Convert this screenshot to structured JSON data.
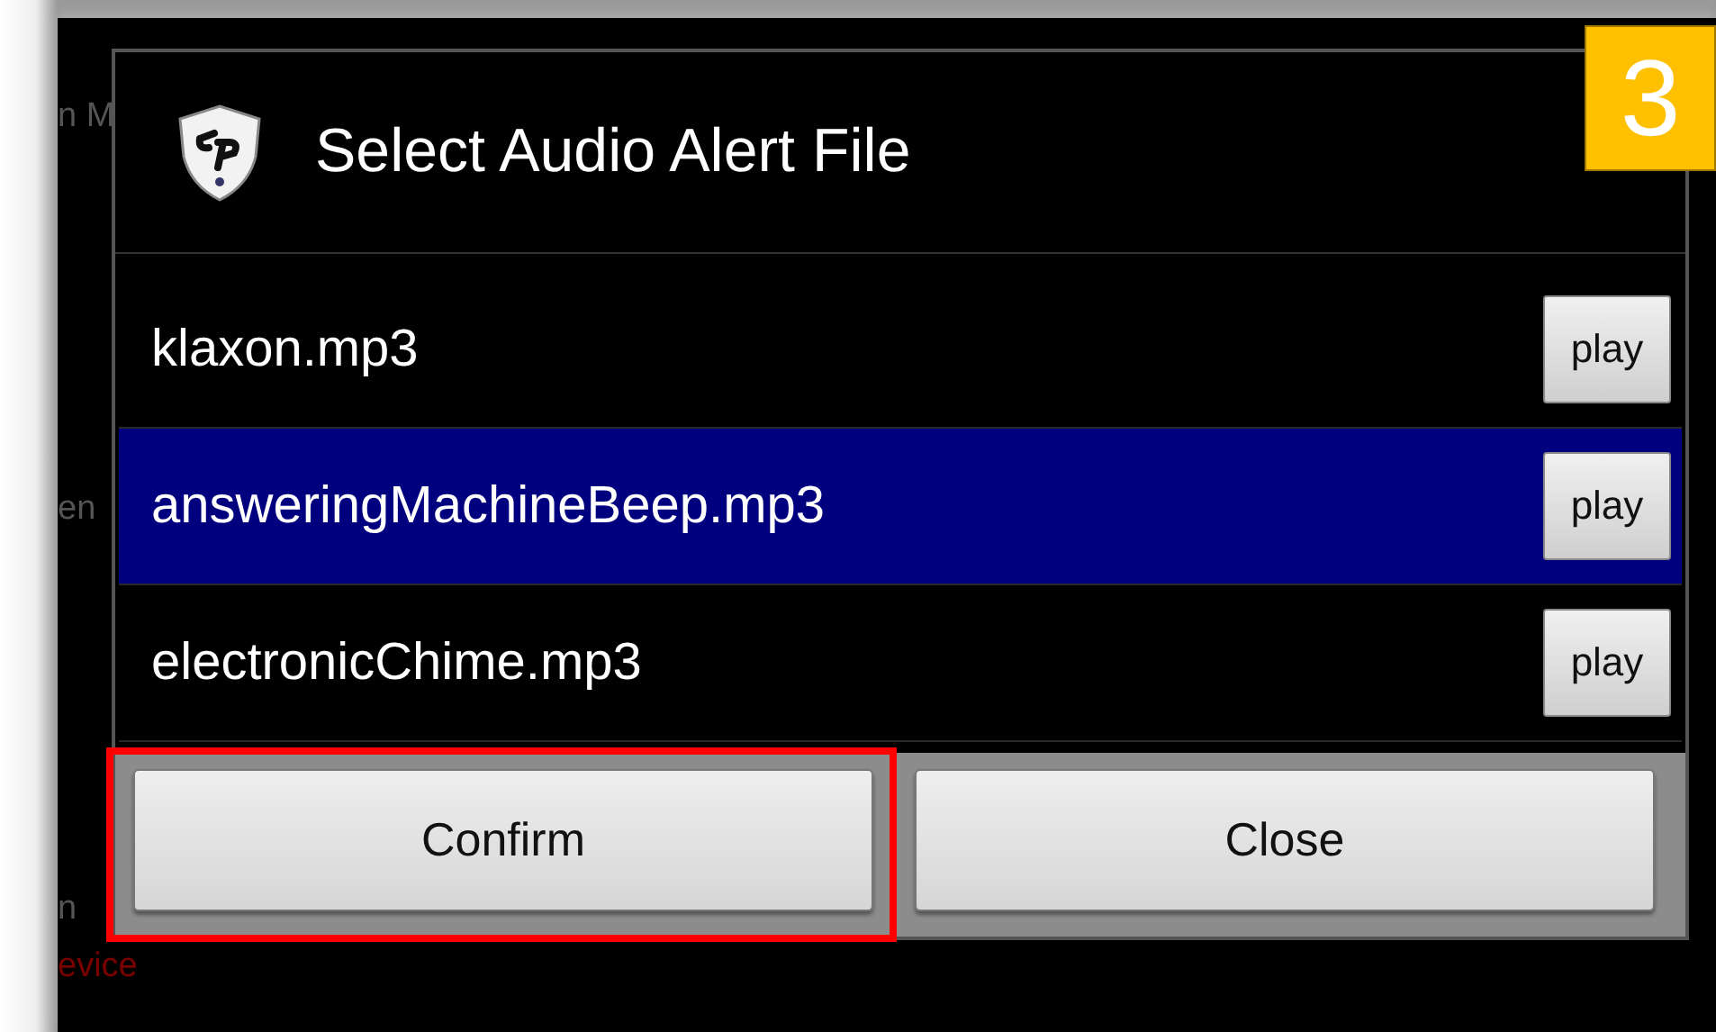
{
  "background_texts": [
    {
      "text": "n M",
      "color": "#555555"
    },
    {
      "text": "en",
      "color": "#555555"
    },
    {
      "text": "n",
      "color": "#555555"
    },
    {
      "text": "evice",
      "color": "#7a0000"
    }
  ],
  "dialog": {
    "title": "Select Audio Alert File",
    "files": [
      {
        "name": "klaxon.mp3",
        "selected": false,
        "button": "play"
      },
      {
        "name": "answeringMachineBeep.mp3",
        "selected": true,
        "button": "play"
      },
      {
        "name": "electronicChime.mp3",
        "selected": false,
        "button": "play"
      }
    ],
    "buttons": [
      {
        "label": "Confirm",
        "highlighted": true
      },
      {
        "label": "Close",
        "highlighted": false
      }
    ]
  },
  "step_badge": "3"
}
